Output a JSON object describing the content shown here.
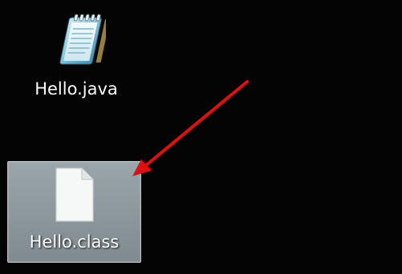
{
  "desktop": {
    "icons": [
      {
        "label": "Hello.java",
        "icon": "notepad-icon",
        "selected": false
      },
      {
        "label": "Hello.class",
        "icon": "blank-file-icon",
        "selected": true
      }
    ],
    "annotation": {
      "type": "arrow",
      "color": "#e01010"
    }
  },
  "colors": {
    "background": "#040404",
    "selection": "#8f9b9f",
    "arrow": "#e01010",
    "label": "#ffffff"
  }
}
